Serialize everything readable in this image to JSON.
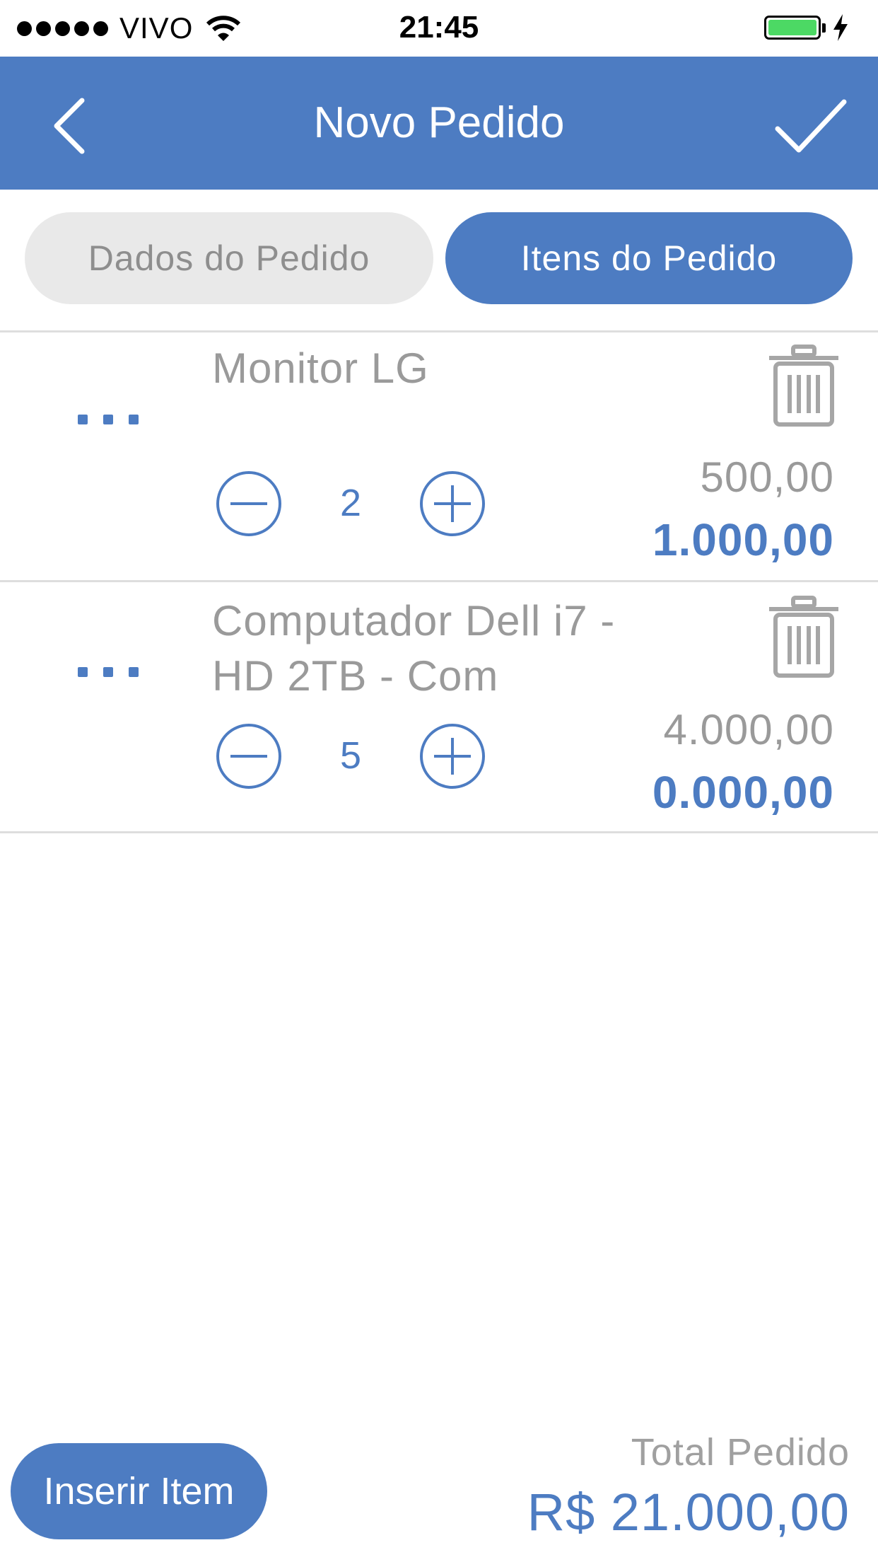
{
  "status_bar": {
    "carrier": "VIVO",
    "time": "21:45",
    "signal_icon": "signal-dots-icon",
    "wifi_icon": "wifi-icon",
    "battery_icon": "battery-icon",
    "charging_icon": "lightning-icon",
    "battery_color": "#4cd964"
  },
  "nav": {
    "title": "Novo Pedido",
    "back_icon": "chevron-left-icon",
    "confirm_icon": "checkmark-icon",
    "color": "#4d7cc2"
  },
  "tabs": [
    {
      "label": "Dados do Pedido",
      "active": false
    },
    {
      "label": "Itens do Pedido",
      "active": true
    }
  ],
  "items": [
    {
      "name": "Monitor LG",
      "quantity": "2",
      "unit_price": "500,00",
      "total": "1.000,00"
    },
    {
      "name": "Computador Dell i7 - HD 2TB - Com",
      "quantity": "5",
      "unit_price": "4.000,00",
      "total": "0.000,00"
    }
  ],
  "item_icons": {
    "more": "more-dots-icon",
    "delete": "trash-icon",
    "decrement": "minus-circle-icon",
    "increment": "plus-circle-icon"
  },
  "footer": {
    "insert_label": "Inserir Item",
    "total_label": "Total Pedido",
    "total_value": "R$ 21.000,00"
  }
}
